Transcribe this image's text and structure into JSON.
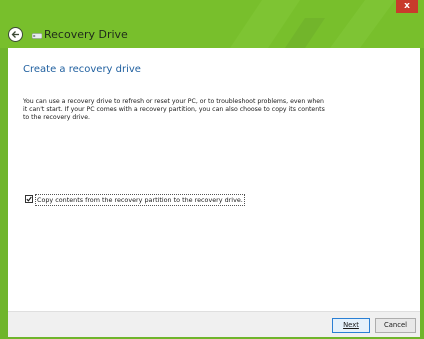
{
  "window": {
    "title": "Recovery Drive",
    "close_label": "x",
    "accent_color": "#78bf2c"
  },
  "icons": {
    "back": "back-arrow-icon",
    "app": "drive-icon"
  },
  "page": {
    "heading": "Create a recovery drive",
    "description_lines": [
      "You can use a recovery drive to refresh or reset your PC, or to troubleshoot problems, even when",
      "it can't start. If your PC comes with a recovery partition, you can also choose to copy its contents",
      "to the recovery drive."
    ]
  },
  "options": {
    "copy_partition": {
      "label": "Copy contents from the recovery partition to the recovery drive.",
      "checked": true
    }
  },
  "buttons": {
    "next": "Next",
    "cancel": "Cancel"
  }
}
